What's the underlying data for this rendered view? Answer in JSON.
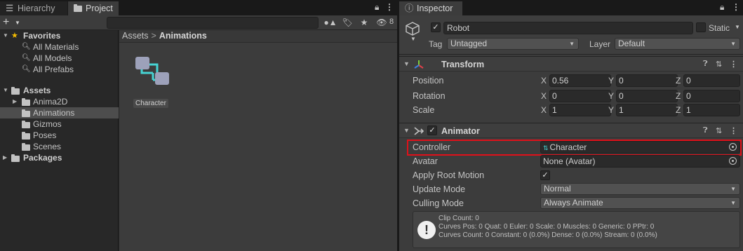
{
  "left_tabs": [
    {
      "label": "Hierarchy",
      "icon": "hierarchy-icon"
    },
    {
      "label": "Project",
      "icon": "folder-icon"
    }
  ],
  "project_toolbar": {
    "create_label": "+",
    "search_placeholder": "",
    "hidden_count": "8"
  },
  "tree": {
    "favorites_label": "Favorites",
    "favorites": [
      "All Materials",
      "All Models",
      "All Prefabs"
    ],
    "assets_label": "Assets",
    "asset_folders": [
      "Anima2D",
      "Animations",
      "Gizmos",
      "Poses",
      "Scenes"
    ],
    "selected_folder": "Animations",
    "packages_label": "Packages"
  },
  "breadcrumb": {
    "root": "Assets",
    "separator": ">",
    "current": "Animations"
  },
  "asset_item": {
    "label": "Character",
    "icon": "animator-controller-icon"
  },
  "inspector": {
    "tab_label": "Inspector",
    "gameobject": {
      "name": "Robot",
      "active": true,
      "static_label": "Static",
      "static": false,
      "tag_label": "Tag",
      "tag_value": "Untagged",
      "layer_label": "Layer",
      "layer_value": "Default"
    },
    "transform": {
      "title": "Transform",
      "rows": [
        {
          "label": "Position",
          "x": "0.56",
          "y": "0",
          "z": "0"
        },
        {
          "label": "Rotation",
          "x": "0",
          "y": "0",
          "z": "0"
        },
        {
          "label": "Scale",
          "x": "1",
          "y": "1",
          "z": "1"
        }
      ],
      "axis_labels": [
        "X",
        "Y",
        "Z"
      ]
    },
    "animator": {
      "title": "Animator",
      "enabled": true,
      "controller_label": "Controller",
      "controller_value": "Character",
      "avatar_label": "Avatar",
      "avatar_value": "None (Avatar)",
      "apply_root_motion_label": "Apply Root Motion",
      "apply_root_motion": true,
      "update_mode_label": "Update Mode",
      "update_mode_value": "Normal",
      "culling_mode_label": "Culling Mode",
      "culling_mode_value": "Always Animate",
      "info_lines": [
        "Clip Count: 0",
        "Curves Pos: 0 Quat: 0 Euler: 0 Scale: 0 Muscles: 0 Generic: 0 PPtr: 0",
        "Curves Count: 0 Constant: 0 (0.0%) Dense: 0 (0.0%) Stream: 0 (0.0%)"
      ]
    }
  },
  "colors": {
    "highlight": "#e0111a",
    "selection": "#4d4d4d",
    "panel": "#3c3c3c",
    "accent_yellow": "#f4bc02"
  }
}
